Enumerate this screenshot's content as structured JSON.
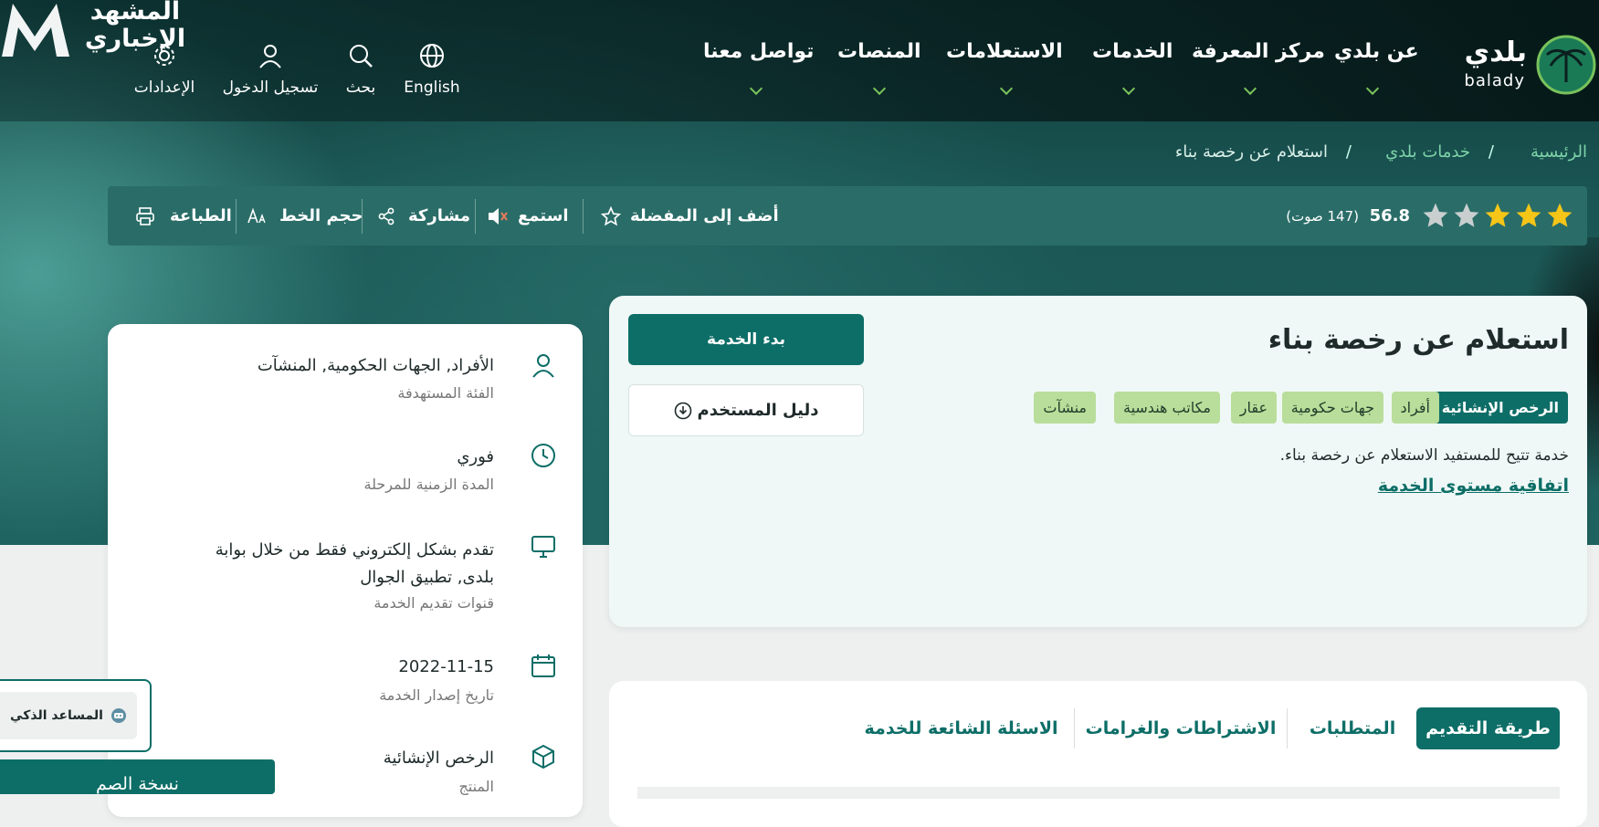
{
  "header": {
    "logo_ar": "بلدي",
    "logo_en": "balady",
    "nav": [
      "عن بلدي",
      "مركز المعرفة",
      "الخدمات",
      "الاستعلامات",
      "المنصات",
      "تواصل معنا"
    ],
    "utils": {
      "language": "English",
      "search": "بحث",
      "login": "تسجيل الدخول",
      "settings": "الإعدادات"
    },
    "watermark": "المشهد الإخباري"
  },
  "breadcrumb": {
    "home": "الرئيسية",
    "services": "خدمات بلدي",
    "current": "استعلام عن رخصة بناء",
    "separator": "/"
  },
  "toolbar": {
    "rating_value": "56.8",
    "rating_votes": "(147 صوت)",
    "rating_stars": 3,
    "favorite": "أضف إلى المفضلة",
    "listen": "استمع",
    "share": "مشاركة",
    "font_size": "حجم الخط",
    "print": "الطباعة"
  },
  "service": {
    "title": "استعلام عن رخصة بناء",
    "tags": [
      "الرخص الإنشائية",
      "أفراد",
      "جهات حكومية",
      "عقار",
      "مكاتب هندسية",
      "منشآت"
    ],
    "description": "خدمة تتيح للمستفيد الاستعلام عن رخصة بناء.",
    "sla_link": "اتفاقية مستوى الخدمة",
    "start_button": "بدء الخدمة",
    "guide_button": "دليل المستخدم"
  },
  "info": [
    {
      "title": "الأفراد, الجهات الحكومية, المنشآت",
      "subtitle": "الفئة المستهدفة",
      "icon": "user-icon"
    },
    {
      "title": "فوري",
      "subtitle": "المدة الزمنية للمرحلة",
      "icon": "clock-icon"
    },
    {
      "title": "تقدم بشكل إلكتروني فقط من خلال بوابة بلدى, تطبيق الجوال",
      "subtitle": "قنوات تقديم الخدمة",
      "icon": "monitor-icon"
    },
    {
      "title": "2022-11-15",
      "subtitle": "تاريخ إصدار الخدمة",
      "icon": "calendar-icon"
    },
    {
      "title": "الرخص الإنشائية",
      "subtitle": "المنتج",
      "icon": "box-icon"
    }
  ],
  "tabs": [
    "طريقة التقديم",
    "المتطلبات",
    "الاشتراطات والغرامات",
    "الاسئلة الشائعة للخدمة"
  ],
  "floating": {
    "assistant": "المساعد الذكي",
    "deaf_version": "نسخة الصم"
  },
  "colors": {
    "primary": "#0d6e67",
    "accent_green": "#79c25b",
    "tag_bg": "#b9dd9a",
    "star": "#f5c518"
  }
}
